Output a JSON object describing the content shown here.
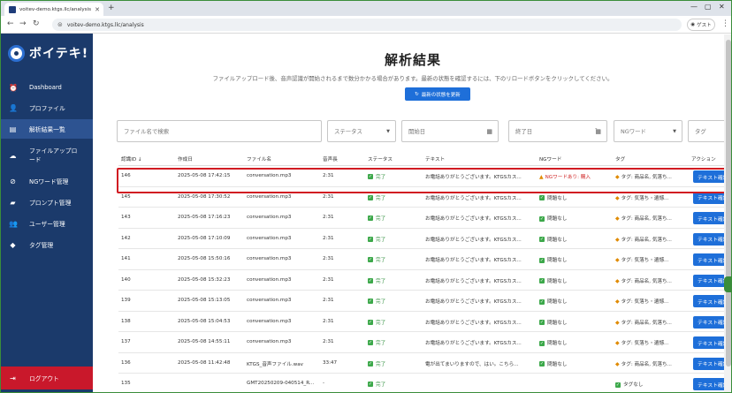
{
  "browser": {
    "tab_title": "voitev-demo.ktgs.llc/analysis",
    "url": "voitev-demo.ktgs.llc/analysis",
    "profile_label": "ゲスト"
  },
  "brand": {
    "name": "ボイテキ!"
  },
  "nav": [
    {
      "label": "Dashboard",
      "icon": "alarm-clock-icon"
    },
    {
      "label": "プロファイル",
      "icon": "person-icon"
    },
    {
      "label": "解析結果一覧",
      "icon": "list-icon",
      "active": true
    },
    {
      "label": "ファイルアップロード",
      "icon": "cloud-upload-icon"
    },
    {
      "label": "NGワード管理",
      "icon": "block-icon"
    },
    {
      "label": "プロンプト管理",
      "icon": "chat-icon"
    },
    {
      "label": "ユーザー管理",
      "icon": "people-icon"
    },
    {
      "label": "タグ管理",
      "icon": "tag-icon"
    }
  ],
  "logout_label": "ログアウト",
  "page": {
    "title": "解析結果",
    "subtitle": "ファイルアップロード後、音声認識が開始されるまで数分かかる場合があります。最新の状態を確認するには、下のリロードボタンをクリックしてください。",
    "refresh_label": "最新の状態を更新"
  },
  "filters": {
    "search_placeholder": "ファイル名で検索",
    "status_placeholder": "ステータス",
    "start_placeholder": "開始日",
    "end_placeholder": "終了日",
    "ng_placeholder": "NGワード",
    "tag_placeholder": "タグ"
  },
  "columns": [
    "認識ID ↓",
    "作成日",
    "ファイル名",
    "音声長",
    "ステータス",
    "テキスト",
    "NGワード",
    "タグ",
    "アクション"
  ],
  "rows": [
    {
      "id": "146",
      "date": "2025-05-08 17:42:15",
      "file": "conversation.mp3",
      "length": "2:31",
      "status": "完了",
      "text": "お電話ありがとうございます。KTGSカス...",
      "ng": "NGワードあり: 購入",
      "ng_flag": true,
      "tag": "タグ: 商品名, 気落ち...",
      "action": "テキスト確認"
    },
    {
      "id": "145",
      "date": "2025-05-08 17:30:52",
      "file": "conversation.mp3",
      "length": "2:31",
      "status": "完了",
      "text": "お電話ありがとうございます。KTGSカス...",
      "ng": "問題なし",
      "ng_flag": false,
      "tag": "タグ: 気落ち・遺憾...",
      "action": "テキスト確認"
    },
    {
      "id": "143",
      "date": "2025-05-08 17:16:23",
      "file": "conversation.mp3",
      "length": "2:31",
      "status": "完了",
      "text": "お電話ありがとうございます。KTGSカス...",
      "ng": "問題なし",
      "ng_flag": false,
      "tag": "タグ: 商品名, 気落ち...",
      "action": "テキスト確認"
    },
    {
      "id": "142",
      "date": "2025-05-08 17:10:09",
      "file": "conversation.mp3",
      "length": "2:31",
      "status": "完了",
      "text": "お電話ありがとうございます。KTGSカス...",
      "ng": "問題なし",
      "ng_flag": false,
      "tag": "タグ: 商品名, 気落ち...",
      "action": "テキスト確認"
    },
    {
      "id": "141",
      "date": "2025-05-08 15:50:16",
      "file": "conversation.mp3",
      "length": "2:31",
      "status": "完了",
      "text": "お電話ありがとうございます。KTGSカス...",
      "ng": "問題なし",
      "ng_flag": false,
      "tag": "タグ: 気落ち・遺憾...",
      "action": "テキスト確認"
    },
    {
      "id": "140",
      "date": "2025-05-08 15:32:23",
      "file": "conversation.mp3",
      "length": "2:31",
      "status": "完了",
      "text": "お電話ありがとうございます。KTGSカス...",
      "ng": "問題なし",
      "ng_flag": false,
      "tag": "タグ: 商品名, 気落ち...",
      "action": "テキスト確認"
    },
    {
      "id": "139",
      "date": "2025-05-08 15:13:05",
      "file": "conversation.mp3",
      "length": "2:31",
      "status": "完了",
      "text": "お電話ありがとうございます。KTGSカス...",
      "ng": "問題なし",
      "ng_flag": false,
      "tag": "タグ: 気落ち・遺憾...",
      "action": "テキスト確認"
    },
    {
      "id": "138",
      "date": "2025-05-08 15:04:53",
      "file": "conversation.mp3",
      "length": "2:31",
      "status": "完了",
      "text": "お電話ありがとうございます。KTGSカス...",
      "ng": "問題なし",
      "ng_flag": false,
      "tag": "タグ: 商品名, 気落ち...",
      "action": "テキスト確認"
    },
    {
      "id": "137",
      "date": "2025-05-08 14:55:11",
      "file": "conversation.mp3",
      "length": "2:31",
      "status": "完了",
      "text": "お電話ありがとうございます。KTGSカス...",
      "ng": "問題なし",
      "ng_flag": false,
      "tag": "タグ: 気落ち・遺憾...",
      "action": "テキスト確認"
    },
    {
      "id": "136",
      "date": "2025-05-08 11:42:48",
      "file": "KTGS_音声ファイル.wav",
      "length": "33:47",
      "status": "完了",
      "text": "電が出てまいりますので、はい。こちら...",
      "ng": "問題なし",
      "ng_flag": false,
      "tag": "タグ: 商品名, 気落ち...",
      "action": "テキスト確認"
    },
    {
      "id": "135",
      "date": "",
      "file": "GMT20250209-040514_R...",
      "length": "-",
      "status": "完了",
      "text": "",
      "ng": "",
      "ng_flag": false,
      "tag": "タグなし",
      "action": "テキスト確認"
    }
  ],
  "colors": {
    "sidebar": "#1b3a6b",
    "accent": "#1e6fd9",
    "logout": "#c9182b",
    "highlight": "#d11b22"
  }
}
